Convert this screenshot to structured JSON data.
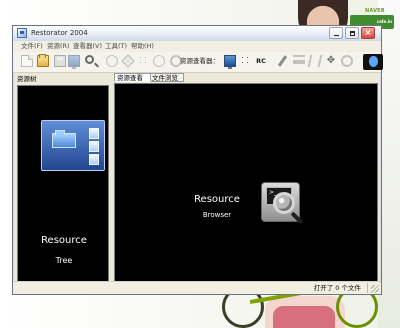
{
  "window": {
    "title": "Restorator 2004",
    "menus": [
      "文件(F)",
      "资源(R)",
      "查看器(V)",
      "工具(T)",
      "帮助(H)"
    ],
    "toolbar_label": "资源查看器：",
    "toolbar_icons": [
      "new-file-icon",
      "open-folder-icon",
      "save-icon",
      "monitor-icon",
      "search-icon",
      "bubble-icon",
      "cube-icon",
      "network-icon",
      "refresh-icon",
      "gear-icon",
      "screen-view-icon",
      "edit-icon",
      "rc-icon",
      "pen-icon",
      "list-icon",
      "dna-icon",
      "move-icon",
      "settings-icon",
      "apple-logo-icon"
    ],
    "rc_label": "RC",
    "tree_header": "资源树",
    "tabs": [
      "资源查看器",
      "文件浏览器"
    ],
    "tree_panel": {
      "title": "Resource",
      "subtitle": "Tree"
    },
    "browser_panel": {
      "title": "Resource",
      "subtitle": "Browser",
      "icon_prompt": ">_"
    },
    "status": "打开了 0 个文件"
  },
  "desktop": {
    "brand_top": "NAVER",
    "brand_sub": "cafe.in"
  },
  "colors": {
    "panel_bg": "#000000",
    "panel_text": "#ffffff",
    "brand_green": "#3f8d2f"
  }
}
